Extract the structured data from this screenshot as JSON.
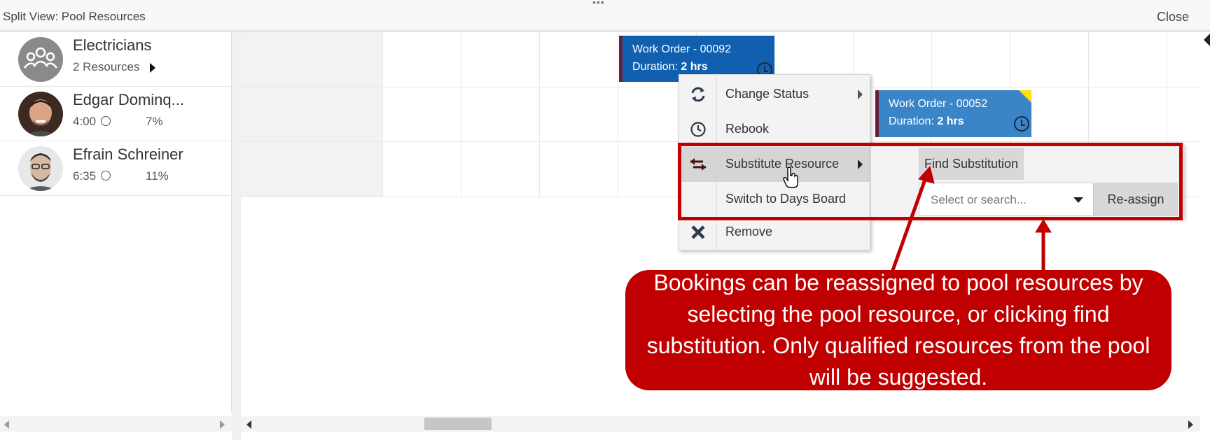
{
  "window": {
    "title": "Split View: Pool Resources",
    "close_label": "Close"
  },
  "resources": [
    {
      "name": "Electricians",
      "sub": "2 Resources",
      "pct": "",
      "type": "pool"
    },
    {
      "name": "Edgar Dominq...",
      "sub": "4:00",
      "pct": "7%",
      "type": "person"
    },
    {
      "name": "Efrain Schreiner",
      "sub": "6:35",
      "pct": "11%",
      "type": "person"
    }
  ],
  "bookings": [
    {
      "title": "Work Order - 00092",
      "duration_label": "Duration:",
      "duration_value": "2 hrs",
      "color": "#1160b0"
    },
    {
      "title": "Work Order - 00052",
      "duration_label": "Duration:",
      "duration_value": "2 hrs",
      "color": "#3a85c8"
    }
  ],
  "context_menu": {
    "items": [
      {
        "label": "Change Status",
        "icon": "refresh-icon",
        "has_submenu": true
      },
      {
        "label": "Rebook",
        "icon": "clock-icon",
        "has_submenu": false
      },
      {
        "label": "Substitute Resource",
        "icon": "swap-icon",
        "has_submenu": true,
        "active": true
      },
      {
        "label": "Switch to Days Board",
        "icon": "",
        "has_submenu": false
      },
      {
        "label": "Remove",
        "icon": "remove-icon",
        "has_submenu": false
      }
    ]
  },
  "submenu": {
    "find_label": "Find Substitution",
    "select_placeholder": "Select or search...",
    "reassign_label": "Re-assign"
  },
  "callout": {
    "text": "Bookings can be reassigned to pool resources by selecting the pool resource, or clicking find substitution.  Only qualified resources from the pool will be suggested."
  },
  "colors": {
    "highlight": "#c00000",
    "booking_dark": "#1160b0",
    "booking_light": "#3a85c8"
  }
}
